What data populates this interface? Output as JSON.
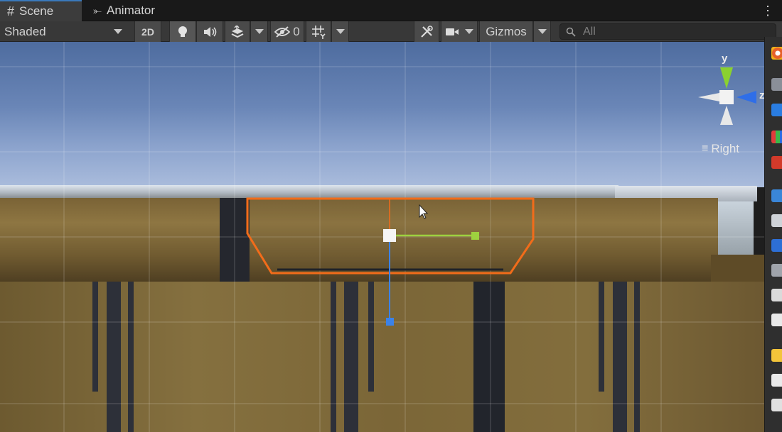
{
  "tabs": [
    {
      "label": "Scene",
      "icon": "hash-icon",
      "active": true
    },
    {
      "label": "Animator",
      "icon": "animator-icon",
      "active": false
    }
  ],
  "toolbar": {
    "shading_mode": "Shaded",
    "mode_2d": "2D",
    "hidden_count": "0",
    "gizmos_label": "Gizmos",
    "search_placeholder": "All"
  },
  "scene": {
    "view_label": "Right",
    "axis_y": "y",
    "axis_z": "z"
  },
  "colors": {
    "selection_outline": "#f26c1a",
    "handle_y": "#9ed13f",
    "handle_z": "#3b82e8",
    "gizmo_y": "#8ad12f",
    "gizmo_z": "#2f6ee8",
    "tab_active_accent": "#3a79bb"
  }
}
